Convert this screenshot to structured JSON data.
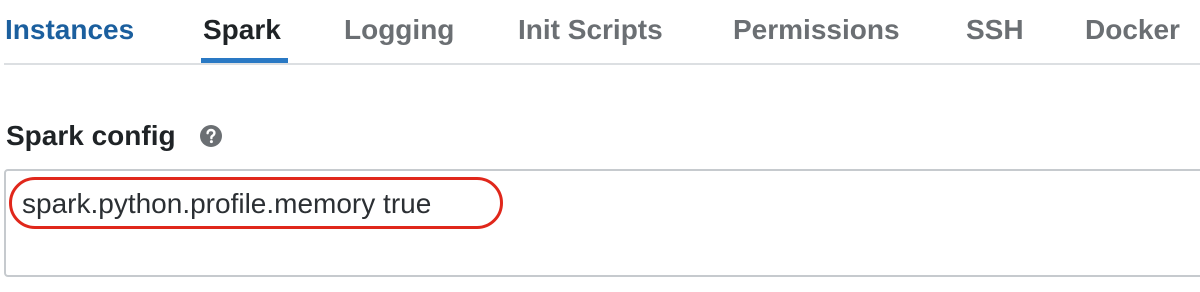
{
  "tabs": [
    {
      "label": "Instances"
    },
    {
      "label": "Spark"
    },
    {
      "label": "Logging"
    },
    {
      "label": "Init Scripts"
    },
    {
      "label": "Permissions"
    },
    {
      "label": "SSH"
    },
    {
      "label": "Docker"
    }
  ],
  "active_tab": "Spark",
  "spark_config": {
    "label": "Spark config",
    "help_icon": "question-circle-icon",
    "value": "spark.python.profile.memory true"
  },
  "colors": {
    "link_tab": "#1b5f9e",
    "active_underline": "#2a79c4",
    "highlight": "#e0271b"
  }
}
